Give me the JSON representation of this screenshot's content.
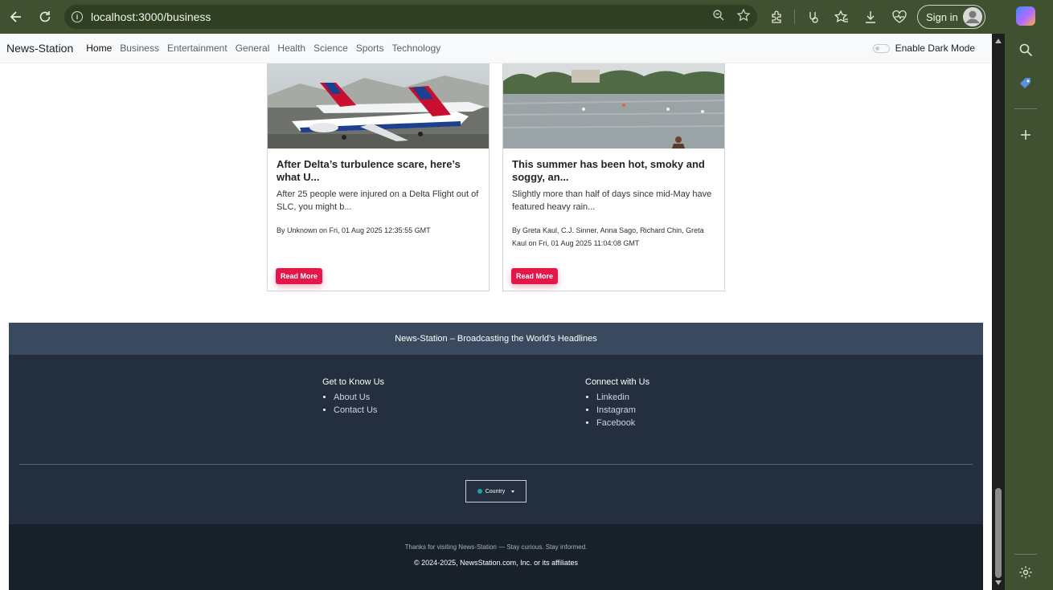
{
  "browser": {
    "url": "localhost:3000/business",
    "sign_in_label": "Sign in"
  },
  "site": {
    "brand": "News-Station",
    "nav_items": [
      "Home",
      "Business",
      "Entertainment",
      "General",
      "Health",
      "Science",
      "Sports",
      "Technology"
    ],
    "active_nav": "Home",
    "dark_mode_label": "Enable Dark Mode"
  },
  "articles": [
    {
      "title": "After Delta’s turbulence scare, here’s what U...",
      "description": "After 25 people were injured on a Delta Flight out of SLC, you might b...",
      "meta": "By Unknown on Fri, 01 Aug 2025 12:35:55 GMT",
      "button": "Read More",
      "image": "airplanes"
    },
    {
      "title": "This summer has been hot, smoky and soggy, an...",
      "description": "Slightly more than half of days since mid-May have featured heavy rain...",
      "meta": "By Greta Kaul, C.J. Sinner, Anna Sago, Richard Chin, Greta Kaul on Fri, 01 Aug 2025 11:04:08 GMT",
      "button": "Read More",
      "image": "lake"
    }
  ],
  "footer": {
    "tagline": "News-Station – Broadcasting the World’s Headlines",
    "col1": {
      "heading": "Get to Know Us",
      "links": [
        "About Us",
        "Contact Us"
      ]
    },
    "col2": {
      "heading": "Connect with Us",
      "links": [
        "Linkedin",
        "Instagram",
        "Facebook"
      ]
    },
    "country_label": "Country",
    "thanks": "Thanks for visiting News-Station — Stay curious. Stay informed.",
    "copyright": "© 2024-2025, NewsStation.com, Inc. or its affiliates"
  },
  "colors": {
    "read_more": "#e4174b",
    "footer_top": "#3a4a5e",
    "footer_mid": "#232f3e",
    "footer_bottom": "#18202a"
  }
}
